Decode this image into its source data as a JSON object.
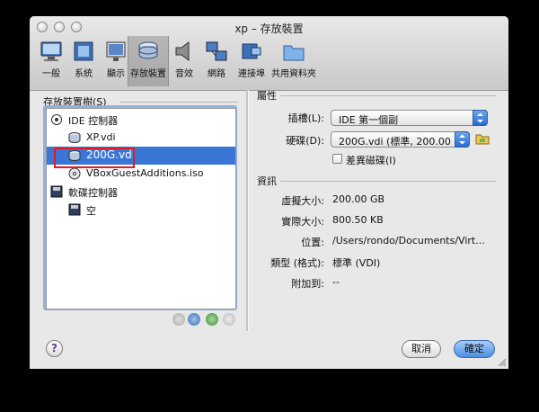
{
  "window": {
    "title": "xp – 存放裝置"
  },
  "toolbar": [
    {
      "label": "一般",
      "icon": "monitor-icon"
    },
    {
      "label": "系統",
      "icon": "chip-icon"
    },
    {
      "label": "顯示",
      "icon": "display-icon"
    },
    {
      "label": "存放裝置",
      "icon": "storage-disks-icon",
      "selected": true
    },
    {
      "label": "音效",
      "icon": "speaker-icon"
    },
    {
      "label": "網路",
      "icon": "network-icon"
    },
    {
      "label": "連接埠",
      "icon": "port-icon"
    },
    {
      "label": "共用資料夾",
      "icon": "folder-icon"
    }
  ],
  "left": {
    "title": "存放裝置樹(S)",
    "tree": [
      {
        "label": "IDE 控制器",
        "icon": "ide-controller-icon"
      },
      {
        "label": "XP.vdi",
        "icon": "hard-disk-icon"
      },
      {
        "label": "200G.vdi",
        "icon": "hard-disk-icon",
        "selected": true
      },
      {
        "label": "VBoxGuestAdditions.iso",
        "icon": "optical-disc-icon"
      },
      {
        "label": "軟碟控制器",
        "icon": "floppy-controller-icon"
      },
      {
        "label": "空",
        "icon": "floppy-icon"
      }
    ]
  },
  "right": {
    "attributes_title": "屬性",
    "slot_label": "插槽(L):",
    "slot_value": "IDE 第一個副",
    "disk_label": "硬碟(D):",
    "disk_value": "200G.vdi (標準, 200.00",
    "diff_label": "差異磁碟(I)",
    "info_title": "資訊",
    "info": [
      {
        "label": "虛擬大小:",
        "value": "200.00 GB"
      },
      {
        "label": "實際大小:",
        "value": "800.50 KB"
      },
      {
        "label": "位置:",
        "value": "/Users/rondo/Documents/Virt..."
      },
      {
        "label": "類型 (格式):",
        "value": "標準 (VDI)"
      },
      {
        "label": "附加到:",
        "value": "--"
      }
    ]
  },
  "buttons": {
    "cancel": "取消",
    "ok": "確定",
    "help": "?"
  },
  "colors": {
    "selection": "#3a76d5",
    "highlight_box": "#e11b24",
    "default_button": "#4b8ee5"
  }
}
